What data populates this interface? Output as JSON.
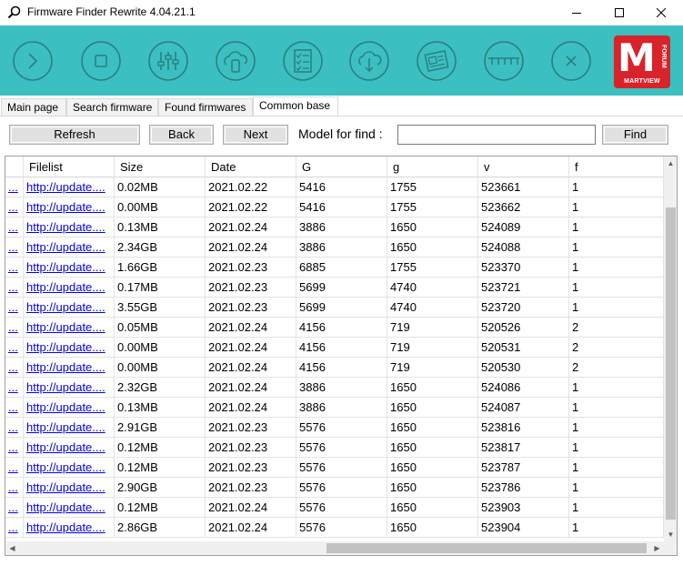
{
  "window": {
    "title": "Firmware Finder Rewrite 4.04.21.1",
    "icon": "magnifier-icon"
  },
  "toolbar": {
    "accent": "#3cbfc0",
    "buttons": [
      {
        "icon": "play-icon"
      },
      {
        "icon": "stop-icon"
      },
      {
        "icon": "sliders-icon"
      },
      {
        "icon": "cloud-phone-icon"
      },
      {
        "icon": "checklist-icon"
      },
      {
        "icon": "cloud-download-icon"
      },
      {
        "icon": "news-icon"
      },
      {
        "icon": "ruler-icon"
      },
      {
        "icon": "close-circle-icon"
      }
    ],
    "logo": {
      "brand": "MARTVIEW",
      "forum": "FORUM",
      "letter": "M",
      "color": "#d8232a"
    }
  },
  "tabs": [
    "Main page",
    "Search firmware",
    "Found firmwares",
    "Common base"
  ],
  "active_tab": "Common base",
  "controls": {
    "refresh": "Refresh",
    "back": "Back",
    "next": "Next",
    "model_label": "Model for find :",
    "model_value": "",
    "find": "Find"
  },
  "grid": {
    "columns": [
      "",
      "Filelist",
      "Size",
      "Date",
      "G",
      "g",
      "v",
      "f"
    ],
    "rows": [
      [
        "...",
        "http://update....",
        "0.02MB",
        "2021.02.22",
        "5416",
        "1755",
        "523661",
        "1"
      ],
      [
        "...",
        "http://update....",
        "0.00MB",
        "2021.02.22",
        "5416",
        "1755",
        "523662",
        "1"
      ],
      [
        "...",
        "http://update....",
        "0.13MB",
        "2021.02.24",
        "3886",
        "1650",
        "524089",
        "1"
      ],
      [
        "...",
        "http://update....",
        "2.34GB",
        "2021.02.24",
        "3886",
        "1650",
        "524088",
        "1"
      ],
      [
        "...",
        "http://update....",
        "1.66GB",
        "2021.02.23",
        "6885",
        "1755",
        "523370",
        "1"
      ],
      [
        "...",
        "http://update....",
        "0.17MB",
        "2021.02.23",
        "5699",
        "4740",
        "523721",
        "1"
      ],
      [
        "...",
        "http://update....",
        "3.55GB",
        "2021.02.23",
        "5699",
        "4740",
        "523720",
        "1"
      ],
      [
        "...",
        "http://update....",
        "0.05MB",
        "2021.02.24",
        "4156",
        "719",
        "520526",
        "2"
      ],
      [
        "...",
        "http://update....",
        "0.00MB",
        "2021.02.24",
        "4156",
        "719",
        "520531",
        "2"
      ],
      [
        "...",
        "http://update....",
        "0.00MB",
        "2021.02.24",
        "4156",
        "719",
        "520530",
        "2"
      ],
      [
        "...",
        "http://update....",
        "2.32GB",
        "2021.02.24",
        "3886",
        "1650",
        "524086",
        "1"
      ],
      [
        "...",
        "http://update....",
        "0.13MB",
        "2021.02.24",
        "3886",
        "1650",
        "524087",
        "1"
      ],
      [
        "...",
        "http://update....",
        "2.91GB",
        "2021.02.23",
        "5576",
        "1650",
        "523816",
        "1"
      ],
      [
        "...",
        "http://update....",
        "0.12MB",
        "2021.02.23",
        "5576",
        "1650",
        "523817",
        "1"
      ],
      [
        "...",
        "http://update....",
        "0.12MB",
        "2021.02.23",
        "5576",
        "1650",
        "523787",
        "1"
      ],
      [
        "...",
        "http://update....",
        "2.90GB",
        "2021.02.23",
        "5576",
        "1650",
        "523786",
        "1"
      ],
      [
        "...",
        "http://update....",
        "0.12MB",
        "2021.02.24",
        "5576",
        "1650",
        "523903",
        "1"
      ],
      [
        "...",
        "http://update....",
        "2.86GB",
        "2021.02.24",
        "5576",
        "1650",
        "523904",
        "1"
      ]
    ]
  }
}
